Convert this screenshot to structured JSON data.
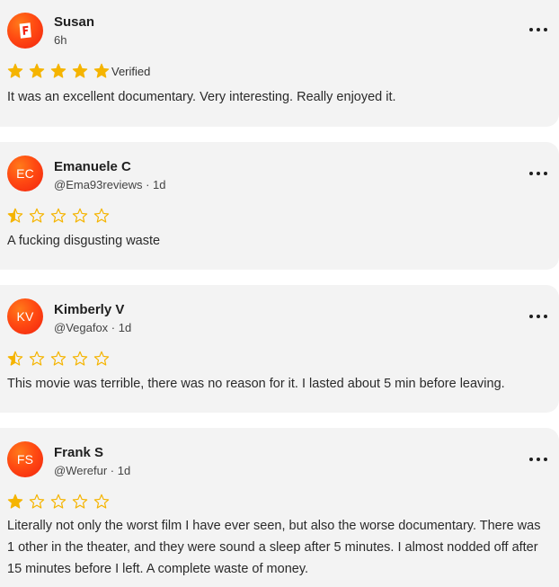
{
  "reviews": [
    {
      "name": "Susan",
      "meta": "6h",
      "avatar_initials": "",
      "avatar_icon": "fandango-icon",
      "rating": 5,
      "verified_label": "Verified",
      "text": "It was an excellent documentary. Very interesting. Really enjoyed it."
    },
    {
      "name": "Emanuele C",
      "meta": "@Ema93reviews · 1d",
      "avatar_initials": "EC",
      "rating": 0.5,
      "text": "A fucking disgusting waste"
    },
    {
      "name": "Kimberly V",
      "meta": "@Vegafox · 1d",
      "avatar_initials": "KV",
      "rating": 0.5,
      "text": "This movie was terrible, there was no reason for it. I lasted about 5 min before leaving."
    },
    {
      "name": "Frank S",
      "meta": "@Werefur · 1d",
      "avatar_initials": "FS",
      "rating": 1,
      "text": "Literally not only the worst film I have ever seen, but also the worse documentary. There was 1 other in the theater, and they were sound a sleep after 5 minutes. I almost nodded off after 15 minutes before I left. A complete waste of money."
    }
  ],
  "colors": {
    "star_fill": "#f5b400",
    "star_outline": "#f5b400",
    "avatar_start": "#ff7a1a",
    "avatar_end": "#f2220f",
    "card_background": "#f3f3f3"
  }
}
